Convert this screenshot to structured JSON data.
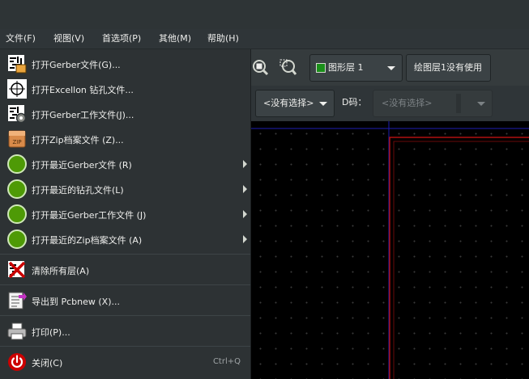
{
  "menubar": {
    "items": [
      "文件(F)",
      "视图(V)",
      "首选项(P)",
      "其他(M)",
      "帮助(H)"
    ]
  },
  "toolbar": {
    "layer_select": "图形层 1",
    "layer_info": "绘图层1没有使用",
    "selection_combo": "<没有选择>",
    "dcode_label": "D码：",
    "dcode_combo": "<没有选择>"
  },
  "file_menu": {
    "open_gerber": "打开Gerber文件(G)...",
    "open_excellon": "打开Excellon 钻孔文件...",
    "open_gerber_job": "打开Gerber工作文件(J)...",
    "open_zip": "打开Zip档案文件 (Z)...",
    "recent_gerber": "打开最近Gerber文件 (R)",
    "recent_drill": "打开最近的钻孔文件(L)",
    "recent_gerber_job": "打开最近Gerber工作文件 (J)",
    "recent_zip": "打开最近的Zip档案文件 (A)",
    "clear_layers": "清除所有层(A)",
    "export_pcbnew": "导出到 Pcbnew (X)...",
    "print": "打印(P)...",
    "close": "关闭(C)",
    "close_accel": "Ctrl+Q"
  },
  "colors": {
    "layer_swatch": "#1a8f1a",
    "canvas": "#000000",
    "board_outline": "#b01010",
    "axis": "#1e1eb4"
  },
  "icons": [
    "gerber-file-icon",
    "drill-file-icon",
    "gerber-job-icon",
    "zip-icon",
    "recent-clock-icon",
    "clear-layers-icon",
    "export-pcbnew-icon",
    "printer-icon",
    "power-icon",
    "zoom-fit-icon",
    "zoom-selection-icon"
  ]
}
